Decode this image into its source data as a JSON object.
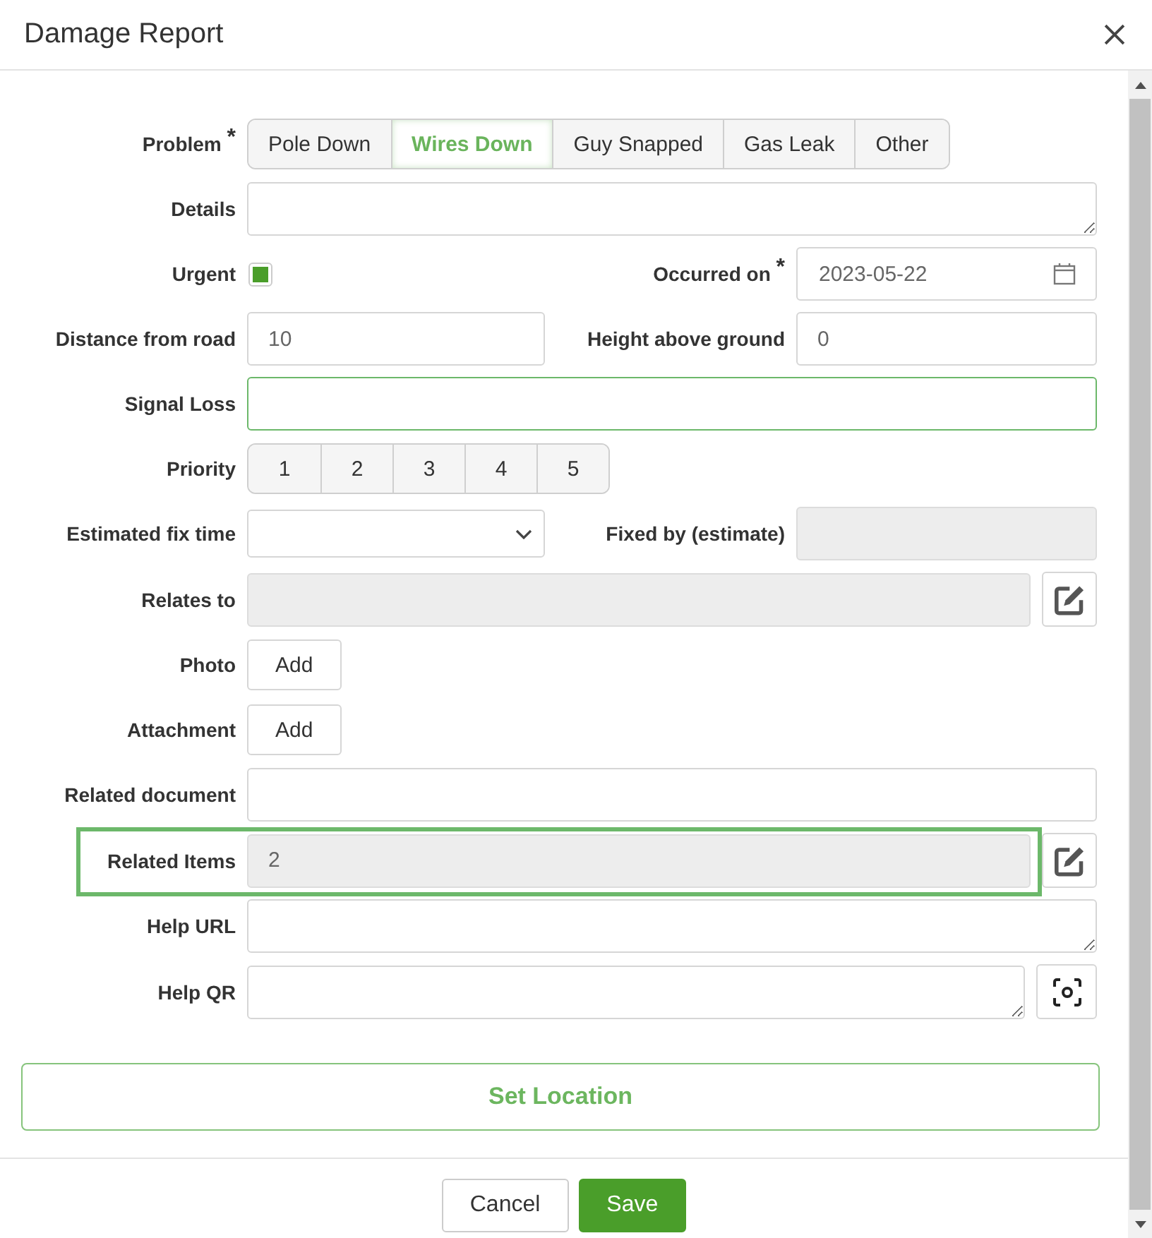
{
  "dialog": {
    "title": "Damage Report"
  },
  "form": {
    "rows": [
      {
        "highlighted": false,
        "fields": [
          {
            "kind": "segmented",
            "label": "Problem $^{*}$",
            "options": [
              {
                "label": "Pole Down",
                "selected": false
              },
              {
                "label": "Wires Down",
                "selected": true
              },
              {
                "label": "Guy Snapped",
                "selected": false
              },
              {
                "label": "Gas Leak",
                "selected": false
              },
              {
                "label": "Other",
                "selected": false
              }
            ]
          }
        ]
      },
      {
        "highlighted": false,
        "fields": [
          {
            "kind": "textarea",
            "label": "Details",
            "disabled": false,
            "focused": false
          }
        ]
      },
      {
        "highlighted": false,
        "fields": [
          {
            "kind": "checkbox",
            "label": "Urgent",
            "checked": true
          },
          {
            "kind": "date",
            "label": "Occurred on $^{*}$",
            "value": "2023-05-22",
            "disabled": false,
            "focused": false
          }
        ]
      },
      {
        "highlighted": false,
        "fields": [
          {
            "kind": "text",
            "label": "Distance from road",
            "value": "10",
            "disabled": false,
            "focused": false
          },
          {
            "kind": "text",
            "label": "Height above ground",
            "value": "0",
            "disabled": false,
            "focused": false
          }
        ]
      },
      {
        "highlighted": false,
        "fields": [
          {
            "kind": "text",
            "label": "Signal Loss",
            "disabled": false,
            "focused": true
          }
        ]
      },
      {
        "highlighted": false,
        "fields": [
          {
            "kind": "segmented",
            "label": "Priority",
            "options": [
              {
                "label": "1",
                "selected": false
              },
              {
                "label": "2",
                "selected": false
              },
              {
                "label": "3",
                "selected": false
              },
              {
                "label": "4",
                "selected": false
              },
              {
                "label": "5",
                "selected": false
              }
            ]
          }
        ]
      },
      {
        "highlighted": false,
        "fields": [
          {
            "kind": "select",
            "label": "Estimated fix time",
            "disabled": false,
            "focused": false
          },
          {
            "kind": "text",
            "label": "Fixed by (estimate)",
            "disabled": true,
            "focused": false
          }
        ]
      },
      {
        "highlighted": false,
        "fields": [
          {
            "kind": "text",
            "label": "Relates to",
            "disabled": true,
            "focused": false,
            "action": {
              "kind": "edit"
            }
          }
        ]
      },
      {
        "highlighted": false,
        "fields": [
          {
            "kind": "button",
            "label": "Photo",
            "button": "Add"
          }
        ]
      },
      {
        "highlighted": false,
        "fields": [
          {
            "kind": "button",
            "label": "Attachment",
            "button": "Add"
          }
        ]
      },
      {
        "highlighted": false,
        "fields": [
          {
            "kind": "text",
            "label": "Related document",
            "disabled": false,
            "focused": false
          }
        ]
      },
      {
        "highlighted": true,
        "fields": [
          {
            "kind": "text",
            "label": "Related Items",
            "value": "2",
            "disabled": true,
            "focused": false,
            "action": {
              "kind": "edit"
            }
          }
        ]
      },
      {
        "highlighted": false,
        "fields": [
          {
            "kind": "textarea",
            "label": "Help URL",
            "disabled": false,
            "focused": false
          }
        ]
      },
      {
        "highlighted": false,
        "fields": [
          {
            "kind": "textarea",
            "label": "Help QR",
            "disabled": false,
            "focused": false,
            "action": {
              "kind": "scan"
            }
          }
        ]
      }
    ],
    "set_location_button": "Set Location"
  },
  "footer": {
    "buttons": [
      {
        "label": "Cancel",
        "kind": "secondary"
      },
      {
        "label": "Save",
        "kind": "primary"
      }
    ]
  }
}
